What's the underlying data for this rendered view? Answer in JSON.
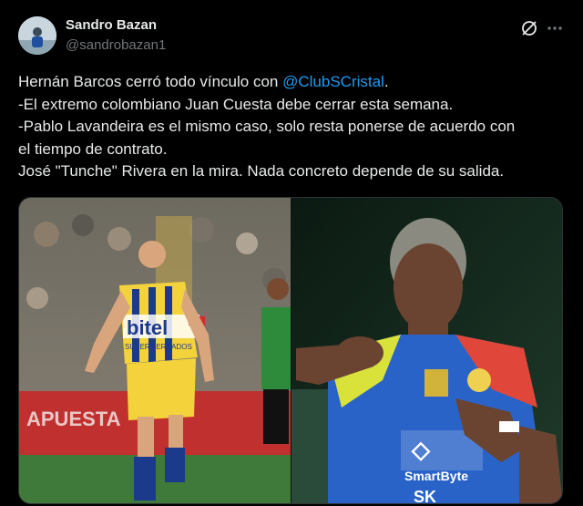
{
  "author": {
    "name": "Sandro Bazan",
    "handle": "@sandrobazan1",
    "avatar_icon": "user-avatar"
  },
  "icons": {
    "grok": "grok-slash-circle-icon",
    "more": "more-horizontal-icon"
  },
  "tweet": {
    "line1_prefix": "Hernán Barcos cerró todo vínculo con ",
    "line1_mention": "@ClubSCristal",
    "line1_suffix": ".",
    "line2": "-El extremo colombiano Juan Cuesta debe cerrar esta semana.",
    "line3": "-Pablo Lavandeira es el mismo caso, solo resta ponerse de acuerdo con",
    "line4": "el tiempo de contrato.",
    "line5": "José \"Tunche\" Rivera en la mira. Nada concreto depende de su salida."
  },
  "media": {
    "left_photo": {
      "jersey_sponsor": "bitel",
      "jersey_sub": "SUPERMERCADOS",
      "banner": "APUESTA"
    },
    "right_photo": {
      "jersey_sponsor": "SmartByte",
      "jersey_sub": "SK"
    }
  },
  "colors": {
    "background": "#000000",
    "text": "#e7e9ea",
    "secondary": "#71767b",
    "link": "#1d9bf0",
    "border": "#2f3336"
  }
}
